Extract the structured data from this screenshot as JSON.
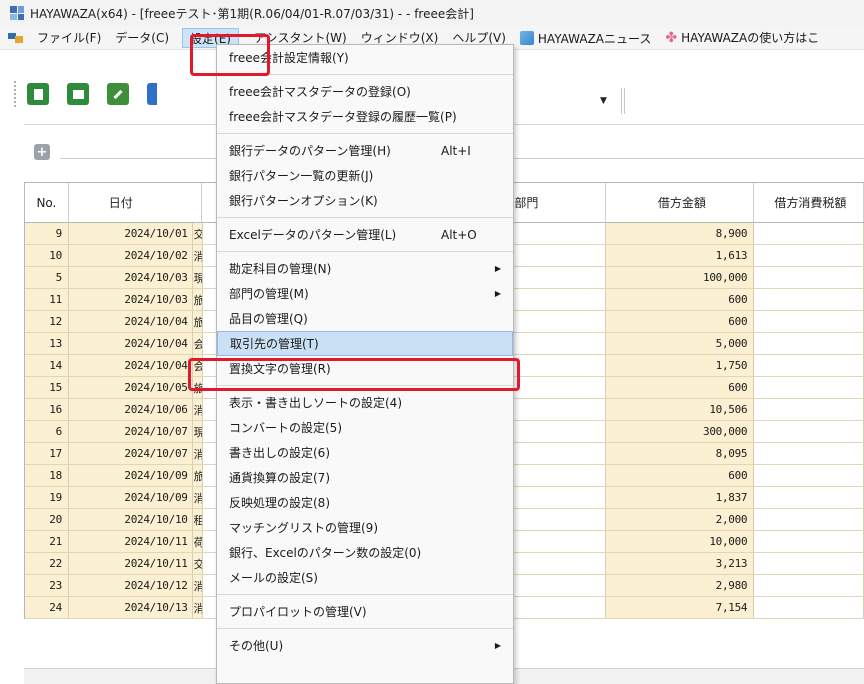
{
  "window": {
    "title": "HAYAWAZA(x64) - [freeeテスト･第1期(R.06/04/01-R.07/03/31) - - freee会計]"
  },
  "menubar": {
    "items": [
      {
        "label": "ファイル(F)"
      },
      {
        "label": "データ(C)"
      },
      {
        "label": "設定(E)"
      },
      {
        "label": "アシスタント(W)"
      },
      {
        "label": "ウィンドウ(X)"
      },
      {
        "label": "ヘルプ(V)"
      },
      {
        "label": "HAYAWAZAニュース"
      },
      {
        "label": "HAYAWAZAの使い方はこ"
      }
    ]
  },
  "grid": {
    "columns": {
      "no": "No.",
      "date": "日付",
      "dept": "方部門",
      "amount": "借方金額",
      "tax": "借方消費税額"
    },
    "rows": [
      {
        "no": "9",
        "date": "2024/10/01",
        "desc": "交",
        "amount": "8,900"
      },
      {
        "no": "10",
        "date": "2024/10/02",
        "desc": "消",
        "amount": "1,613"
      },
      {
        "no": "5",
        "date": "2024/10/03",
        "desc": "現",
        "amount": "100,000"
      },
      {
        "no": "11",
        "date": "2024/10/03",
        "desc": "旅",
        "amount": "600"
      },
      {
        "no": "12",
        "date": "2024/10/04",
        "desc": "旅",
        "amount": "600"
      },
      {
        "no": "13",
        "date": "2024/10/04",
        "desc": "会",
        "amount": "5,000"
      },
      {
        "no": "14",
        "date": "2024/10/04",
        "desc": "会",
        "amount": "1,750"
      },
      {
        "no": "15",
        "date": "2024/10/05",
        "desc": "旅",
        "amount": "600"
      },
      {
        "no": "16",
        "date": "2024/10/06",
        "desc": "消",
        "amount": "10,506"
      },
      {
        "no": "6",
        "date": "2024/10/07",
        "desc": "現",
        "amount": "300,000"
      },
      {
        "no": "17",
        "date": "2024/10/07",
        "desc": "消",
        "amount": "8,095"
      },
      {
        "no": "18",
        "date": "2024/10/09",
        "desc": "旅",
        "amount": "600"
      },
      {
        "no": "19",
        "date": "2024/10/09",
        "desc": "消",
        "amount": "1,837"
      },
      {
        "no": "20",
        "date": "2024/10/10",
        "desc": "租",
        "amount": "2,000"
      },
      {
        "no": "21",
        "date": "2024/10/11",
        "desc": "荷",
        "amount": "10,000"
      },
      {
        "no": "22",
        "date": "2024/10/11",
        "desc": "交",
        "amount": "3,213"
      },
      {
        "no": "23",
        "date": "2024/10/12",
        "desc": "消",
        "amount": "2,980"
      },
      {
        "no": "24",
        "date": "2024/10/13",
        "desc": "消",
        "amount": "7,154"
      }
    ]
  },
  "dropdown": {
    "groups": [
      [
        {
          "label": "freee会計設定情報(Y)"
        }
      ],
      [
        {
          "label": "freee会計マスタデータの登録(O)"
        },
        {
          "label": "freee会計マスタデータ登録の履歴一覧(P)"
        }
      ],
      [
        {
          "label": "銀行データのパターン管理(H)",
          "accel": "Alt+I"
        },
        {
          "label": "銀行パターン一覧の更新(J)"
        },
        {
          "label": "銀行パターンオプション(K)"
        }
      ],
      [
        {
          "label": "Excelデータのパターン管理(L)",
          "accel": "Alt+O"
        }
      ],
      [
        {
          "label": "勘定科目の管理(N)",
          "submenu": true
        },
        {
          "label": "部門の管理(M)",
          "submenu": true
        },
        {
          "label": "品目の管理(Q)"
        },
        {
          "label": "取引先の管理(T)",
          "highlighted": true
        },
        {
          "label": "置換文字の管理(R)"
        }
      ],
      [
        {
          "label": "表示・書き出しソートの設定(4)"
        },
        {
          "label": "コンバートの設定(5)"
        },
        {
          "label": "書き出しの設定(6)"
        },
        {
          "label": "通貨換算の設定(7)"
        },
        {
          "label": "反映処理の設定(8)"
        },
        {
          "label": "マッチングリストの管理(9)"
        },
        {
          "label": "銀行、Excelのパターン数の設定(0)"
        },
        {
          "label": "メールの設定(S)"
        }
      ],
      [
        {
          "label": "プロパイロットの管理(V)"
        }
      ],
      [
        {
          "label": "その他(U)",
          "submenu": true
        }
      ]
    ]
  },
  "colors": {
    "highlight_red": "#e3182d",
    "selected_bg": "#c9e0f5",
    "grid_cell_bg": "#fbf1d2"
  }
}
